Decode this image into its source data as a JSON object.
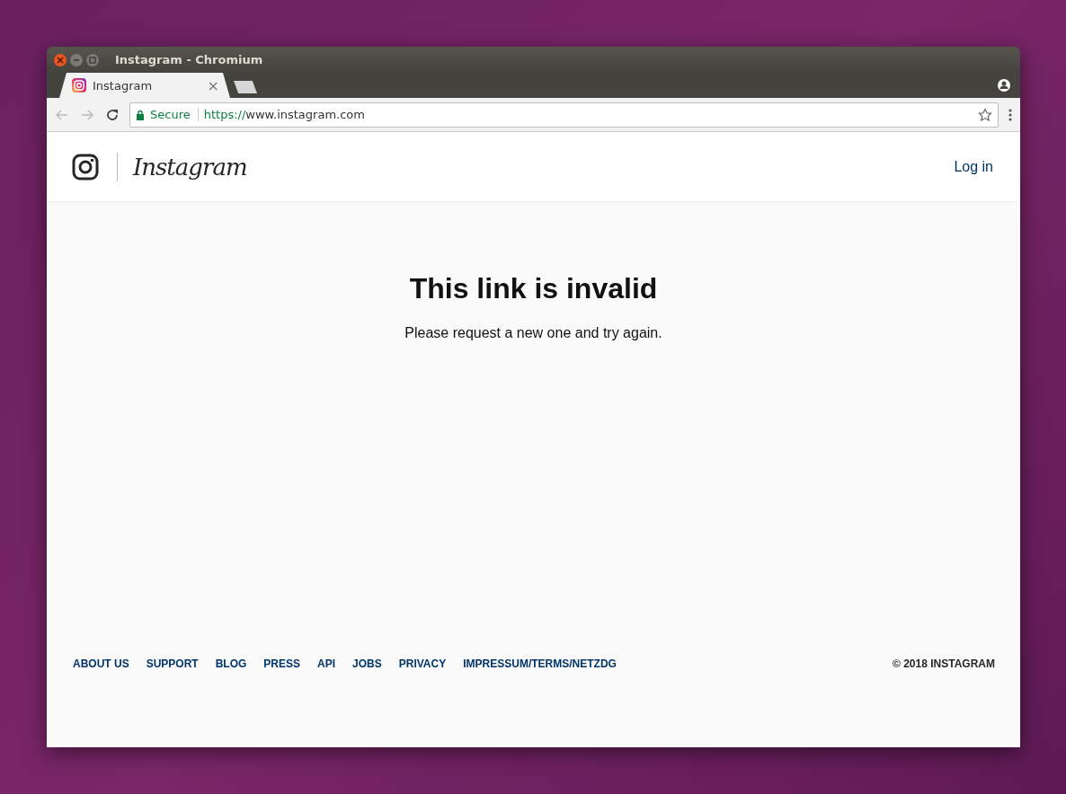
{
  "window": {
    "title": "Instagram - Chromium"
  },
  "tabs": [
    {
      "label": "Instagram",
      "selected": true,
      "close": "×"
    }
  ],
  "address_bar": {
    "secure_label": "Secure",
    "scheme": "https://",
    "host": "www.instagram.com"
  },
  "header": {
    "logo_text": "Instagram",
    "login": "Log in"
  },
  "main": {
    "heading": "This link is invalid",
    "message": "Please request a new one and try again."
  },
  "footer": {
    "links": [
      "ABOUT US",
      "SUPPORT",
      "BLOG",
      "PRESS",
      "API",
      "JOBS",
      "PRIVACY",
      "IMPRESSUM/TERMS/NETZDG"
    ],
    "copyright": "© 2018 INSTAGRAM"
  }
}
